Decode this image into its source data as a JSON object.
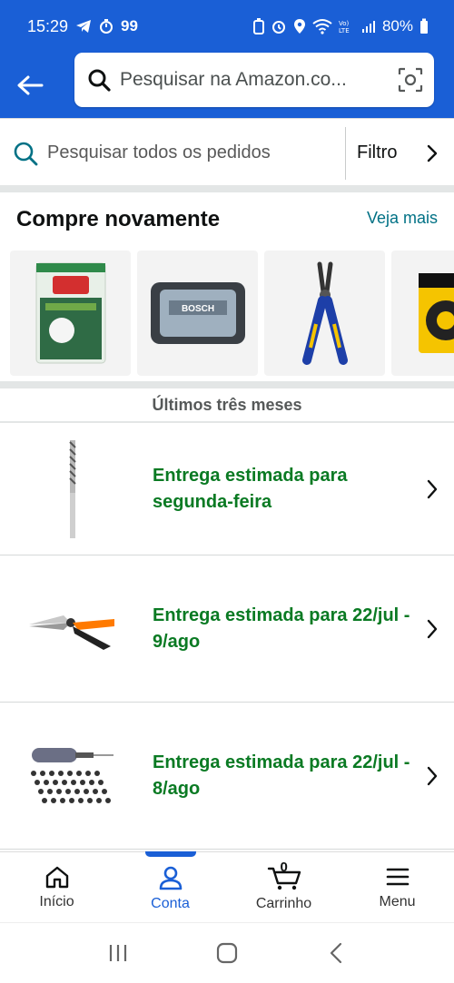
{
  "status_bar": {
    "time": "15:29",
    "badge": "99",
    "battery": "80%"
  },
  "header": {
    "search_placeholder": "Pesquisar na Amazon.co...",
    "brand_color": "#1a5fd6"
  },
  "orders_search": {
    "placeholder": "Pesquisar todos os pedidos",
    "filter_label": "Filtro"
  },
  "buy_again": {
    "title": "Compre novamente",
    "see_more": "Veja mais",
    "products": [
      {
        "icon": "scotch-brite-sponge-pack"
      },
      {
        "icon": "bosch-bit-case"
      },
      {
        "icon": "irwin-pliers"
      },
      {
        "icon": "insulating-tape-roll"
      }
    ]
  },
  "orders": {
    "period_label": "Últimos três meses",
    "items": [
      {
        "status": "Entrega estimada para segunda-feira",
        "icon": "drill-bit"
      },
      {
        "status": "Entrega estimada para 22/jul - 9/ago",
        "icon": "pruning-shears"
      },
      {
        "status": "Entrega estimada para 22/jul - 8/ago",
        "icon": "rotary-tool-kit"
      }
    ]
  },
  "bottom_nav": {
    "items": [
      {
        "label": "Início",
        "icon": "home-icon"
      },
      {
        "label": "Conta",
        "icon": "account-icon"
      },
      {
        "label": "Carrinho",
        "icon": "cart-icon",
        "count": "0"
      },
      {
        "label": "Menu",
        "icon": "menu-icon"
      }
    ],
    "active_index": 1
  }
}
